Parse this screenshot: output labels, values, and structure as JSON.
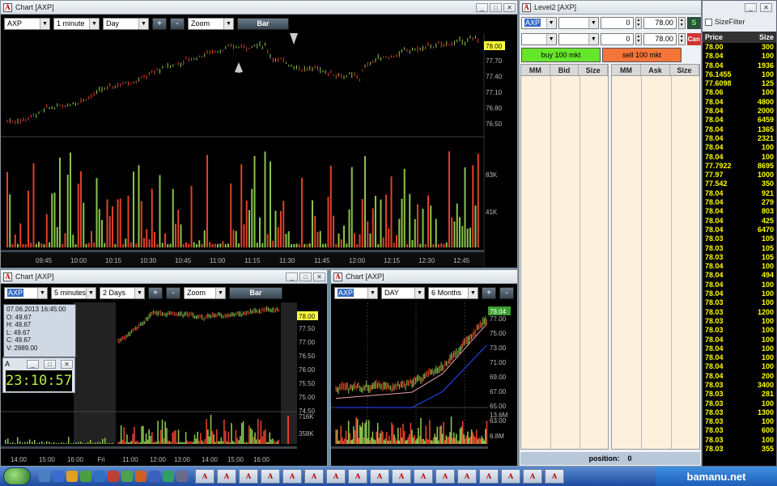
{
  "main_chart": {
    "title": "Chart [AXP]",
    "symbol": "AXP",
    "interval": "1 minute",
    "range": "Day",
    "zoom_label": "Zoom",
    "type_button": "Bar",
    "plus": "+",
    "minus": "-",
    "last_price": "78.00",
    "price_ticks": [
      "77.70",
      "77.40",
      "77.10",
      "76.80",
      "76.50"
    ],
    "volume_ticks": [
      "83K",
      "41K"
    ],
    "time_ticks": [
      "09:45",
      "10:00",
      "10:15",
      "10:30",
      "10:45",
      "11:00",
      "11:15",
      "11:30",
      "11:45",
      "12:00",
      "12:15",
      "12:30",
      "12:45"
    ]
  },
  "chart_5min": {
    "title": "Chart [AXP]",
    "symbol": "AXP",
    "interval": "5 minutes",
    "range": "2 Days",
    "zoom_label": "Zoom",
    "type_button": "Bar",
    "plus": "+",
    "minus": "-",
    "last_price": "78.00",
    "price_ticks": [
      "77.50",
      "77.00",
      "76.50",
      "76.00",
      "75.50",
      "75.00",
      "74.50"
    ],
    "volume_ticks": [
      "716K",
      "358K"
    ],
    "time_ticks": [
      "14:00",
      "15:00",
      "16:00",
      "Fri",
      "11:00",
      "12:00",
      "13:00",
      "14:00",
      "15:00",
      "16:00"
    ],
    "info": {
      "datetime": "07.06.2013 16:45:00",
      "open": "O: 49.67",
      "high": "H: 49.67",
      "low": "L: 49.67",
      "close": "C: 49.67",
      "volume": "V: 2989.00"
    }
  },
  "clock": {
    "time": "23:10:57"
  },
  "chart_daily": {
    "title": "Chart [AXP]",
    "symbol": "AXP",
    "interval": "DAY",
    "range": "6 Months",
    "plus": "+",
    "minus": "-",
    "last_price": "78.04",
    "price_ticks": [
      "77.00",
      "75.00",
      "73.00",
      "71.00",
      "69.00",
      "67.00",
      "65.00",
      "63.00"
    ],
    "volume_ticks": [
      "13.6M",
      "6.8M"
    ]
  },
  "level2": {
    "title": "Level2 [AXP]",
    "symbol": "AXP",
    "qty1": "0",
    "price1": "78.00",
    "qty2": "0",
    "price2": "78.00",
    "s_label": "S",
    "can_label": "Can",
    "buy_button": "buy 100 mkt",
    "sell_button": "sell 100 mkt",
    "bid_headers": [
      "MM",
      "Bid",
      "Size"
    ],
    "ask_headers": [
      "MM",
      "Ask",
      "Size"
    ],
    "position_label": "position:",
    "position_value": "0",
    "buy_color": "#66e62a",
    "sell_color": "#f4743a"
  },
  "time_sales": {
    "size_filter_label": "SizeFilter",
    "headers": [
      "Price",
      "Size"
    ],
    "rows": [
      [
        "78.00",
        "300"
      ],
      [
        "78.04",
        "100"
      ],
      [
        "78.04",
        "1936"
      ],
      [
        "76.1455",
        "100"
      ],
      [
        "77.6098",
        "125"
      ],
      [
        "78.06",
        "100"
      ],
      [
        "78.04",
        "4800"
      ],
      [
        "78.04",
        "2000"
      ],
      [
        "78.04",
        "6459"
      ],
      [
        "78.04",
        "1365"
      ],
      [
        "78.04",
        "2321"
      ],
      [
        "78.04",
        "100"
      ],
      [
        "78.04",
        "100"
      ],
      [
        "77.7922",
        "8695"
      ],
      [
        "77.97",
        "1000"
      ],
      [
        "77.542",
        "350"
      ],
      [
        "78.04",
        "921"
      ],
      [
        "78.04",
        "279"
      ],
      [
        "78.04",
        "803"
      ],
      [
        "78.04",
        "425"
      ],
      [
        "78.04",
        "6470"
      ],
      [
        "78.03",
        "105"
      ],
      [
        "78.03",
        "105"
      ],
      [
        "78.03",
        "105"
      ],
      [
        "78.04",
        "100"
      ],
      [
        "78.04",
        "494"
      ],
      [
        "78.04",
        "100"
      ],
      [
        "78.04",
        "100"
      ],
      [
        "78.03",
        "100"
      ],
      [
        "78.03",
        "1200"
      ],
      [
        "78.03",
        "100"
      ],
      [
        "78.03",
        "100"
      ],
      [
        "78.04",
        "100"
      ],
      [
        "78.04",
        "100"
      ],
      [
        "78.04",
        "100"
      ],
      [
        "78.04",
        "100"
      ],
      [
        "78.04",
        "200"
      ],
      [
        "78.03",
        "3400"
      ],
      [
        "78.03",
        "281"
      ],
      [
        "78.03",
        "100"
      ],
      [
        "78.03",
        "1300"
      ],
      [
        "78.03",
        "100"
      ],
      [
        "78.03",
        "600"
      ],
      [
        "78.03",
        "100"
      ],
      [
        "78.03",
        "355"
      ]
    ]
  },
  "taskbar": {
    "app_letter": "A",
    "watermark": "bamanu.net"
  }
}
